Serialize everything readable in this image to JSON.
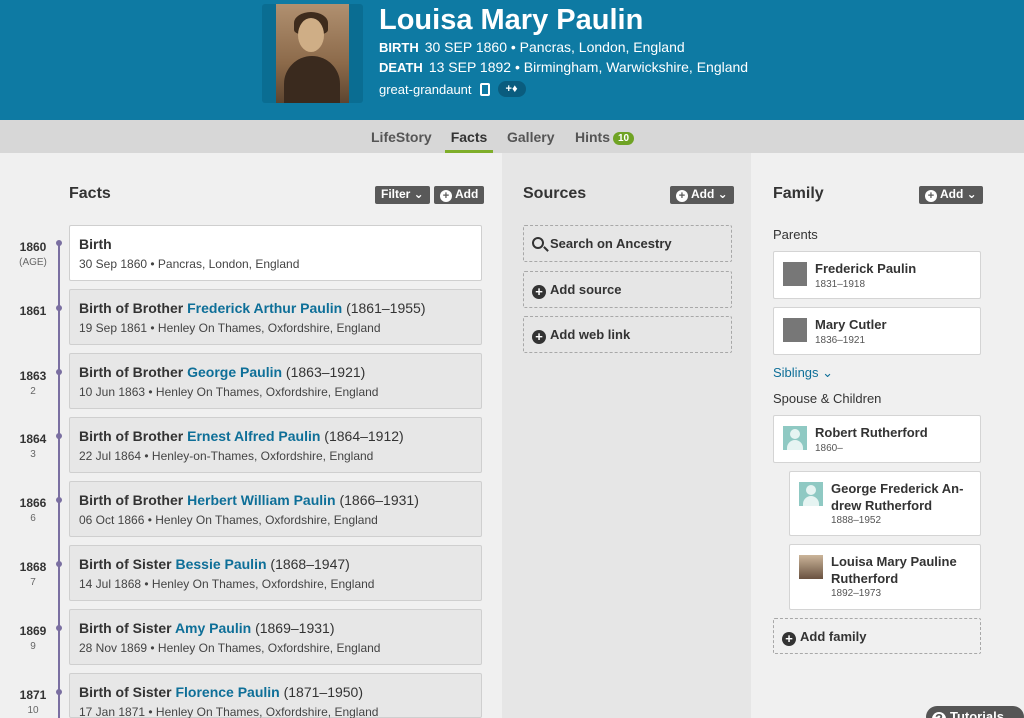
{
  "person": {
    "name": "Louisa Mary Paulin",
    "birth_label": "BIRTH",
    "birth_text": "30 SEP 1860 • Pancras, London, England",
    "death_label": "DEATH",
    "death_text": "13 SEP 1892 • Birmingham, Warwickshire, England",
    "relationship": "great-grandaunt",
    "tag_button": "+♦"
  },
  "tabs": [
    {
      "label": "LifeStory"
    },
    {
      "label": "Facts",
      "active": true
    },
    {
      "label": "Gallery"
    },
    {
      "label": "Hints",
      "badge": "10"
    }
  ],
  "facts": {
    "title": "Facts",
    "filter_label": "Filter",
    "add_label": "Add",
    "items": [
      {
        "year": "1860",
        "age": "(AGE)",
        "prefix": "Birth",
        "person": "",
        "range": "",
        "detail": "30 Sep 1860 • Pancras, London, England"
      },
      {
        "year": "1861",
        "age": "",
        "prefix": "Birth of Brother ",
        "person": "Frederick Arthur Paulin",
        "range": " (1861–1955)",
        "detail": "19 Sep 1861 • Henley On Thames, Oxfordshire, England"
      },
      {
        "year": "1863",
        "age": "2",
        "prefix": "Birth of Brother ",
        "person": "George Paulin",
        "range": " (1863–1921)",
        "detail": "10 Jun 1863 • Henley On Thames, Oxfordshire, England"
      },
      {
        "year": "1864",
        "age": "3",
        "prefix": "Birth of Brother ",
        "person": "Ernest Alfred Paulin",
        "range": " (1864–1912)",
        "detail": "22 Jul 1864 • Henley-on-Thames, Oxfordshire, England"
      },
      {
        "year": "1866",
        "age": "6",
        "prefix": "Birth of Brother ",
        "person": "Herbert William Paulin",
        "range": " (1866–1931)",
        "detail": "06 Oct 1866 • Henley On Thames, Oxfordshire, England"
      },
      {
        "year": "1868",
        "age": "7",
        "prefix": "Birth of Sister ",
        "person": "Bessie Paulin",
        "range": " (1868–1947)",
        "detail": "14 Jul 1868 • Henley On Thames, Oxfordshire, England"
      },
      {
        "year": "1869",
        "age": "9",
        "prefix": "Birth of Sister ",
        "person": "Amy Paulin",
        "range": " (1869–1931)",
        "detail": "28 Nov 1869 • Henley On Thames, Oxfordshire, England"
      },
      {
        "year": "1871",
        "age": "10",
        "prefix": "Birth of Sister ",
        "person": "Florence Paulin",
        "range": " (1871–1950)",
        "detail": "17 Jan 1871 • Henley On Thames, Oxfordshire, England"
      }
    ]
  },
  "sources": {
    "title": "Sources",
    "add_label": "Add",
    "search_label": "Search on Ancestry",
    "add_source_label": "Add source",
    "add_web_link_label": "Add web link"
  },
  "family": {
    "title": "Family",
    "add_label": "Add",
    "parents_label": "Parents",
    "parents": [
      {
        "name": "Frederick Paulin",
        "years": "1831–1918"
      },
      {
        "name": "Mary Cutler",
        "years": "1836–1921"
      }
    ],
    "siblings_label": "Siblings",
    "spouse_children_label": "Spouse & Children",
    "spouse": {
      "name": "Robert Rutherford",
      "years": "1860–"
    },
    "children": [
      {
        "name_line1": "George Frederick An-",
        "name_line2": "drew Rutherford",
        "years": "1888–1952"
      },
      {
        "name_line1": "Louisa Mary Pauline",
        "name_line2": "Rutherford",
        "years": "1892–1973"
      }
    ],
    "add_family_label": "Add family"
  },
  "tutorials_label": "Tutorials"
}
